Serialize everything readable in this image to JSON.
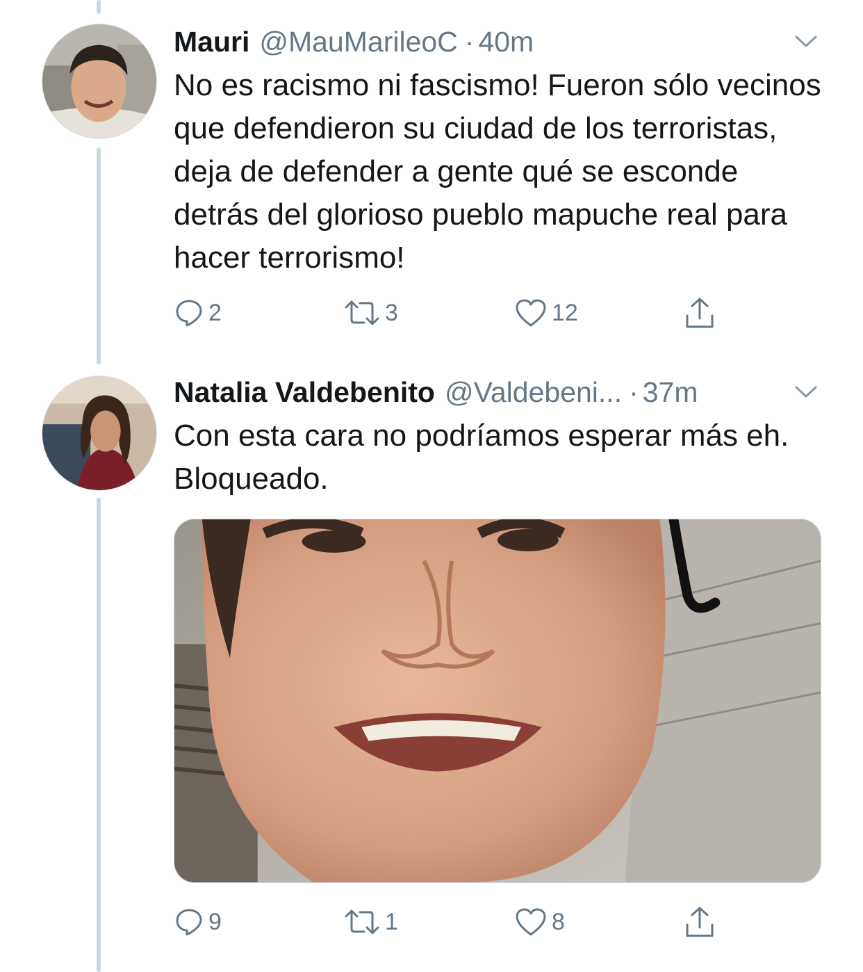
{
  "colors": {
    "text_primary": "#14171a",
    "text_secondary": "#657786",
    "thread_line": "#ccd6dd"
  },
  "tweets": [
    {
      "name": "Mauri",
      "handle": "@MauMarileoC",
      "separator": "·",
      "time": "40m",
      "text": "No es racismo ni fascismo! Fueron sólo vecinos que defendieron su ciudad de los terroristas, deja de defender a gente qué se esconde detrás del glorioso pueblo mapuche real para hacer terrorismo!",
      "replies": "2",
      "retweets": "3",
      "likes": "12",
      "icons": [
        "reply-icon",
        "retweet-icon",
        "like-icon",
        "share-icon",
        "chevron-down-icon"
      ]
    },
    {
      "name": "Natalia Valdebenito",
      "handle": "@Valdebeni...",
      "separator": "·",
      "time": "37m",
      "text": "Con esta cara no podríamos esperar más eh. Bloqueado.",
      "replies": "9",
      "retweets": "1",
      "likes": "8",
      "icons": [
        "reply-icon",
        "retweet-icon",
        "like-icon",
        "share-icon",
        "chevron-down-icon"
      ]
    }
  ]
}
